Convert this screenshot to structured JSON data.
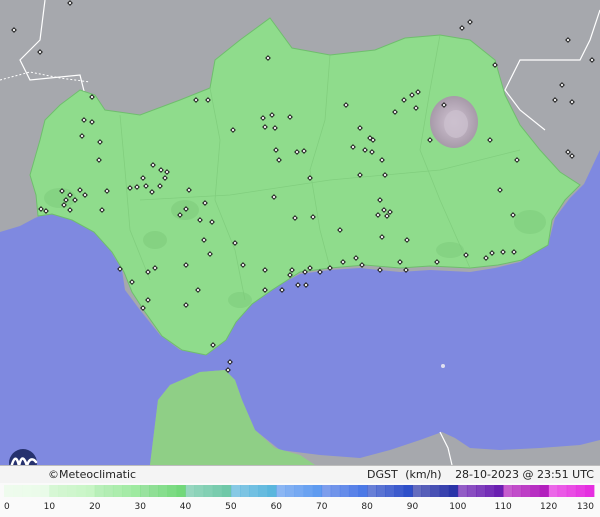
{
  "map": {
    "land_color": "#a6a8ad",
    "sea_color": "#7f89e0",
    "region_color": "#8fdc8c",
    "region_edge": "#6fbe6d",
    "mountain_color": "#b6a9b8",
    "station_icon": "diamond-icon"
  },
  "info": {
    "brand": "©Meteoclimatic",
    "variable": "DGST",
    "unit": "(km/h)",
    "timestamp": "28-10-2023 @ 23:51 UTC"
  },
  "legend": {
    "ticks": [
      "0",
      "10",
      "20",
      "30",
      "40",
      "50",
      "60",
      "70",
      "80",
      "90",
      "100",
      "110",
      "120",
      "130"
    ],
    "colors": [
      "#e9fbe8",
      "#c7f5c5",
      "#9eeaa0",
      "#72d87a",
      "#6fc8a8",
      "#5ab6dd",
      "#5f9bf0",
      "#4c79e6",
      "#2e4fc9",
      "#2a34a8",
      "#6a1fb1",
      "#b21fbd",
      "#e52ee0",
      "#f7a6f2"
    ]
  }
}
